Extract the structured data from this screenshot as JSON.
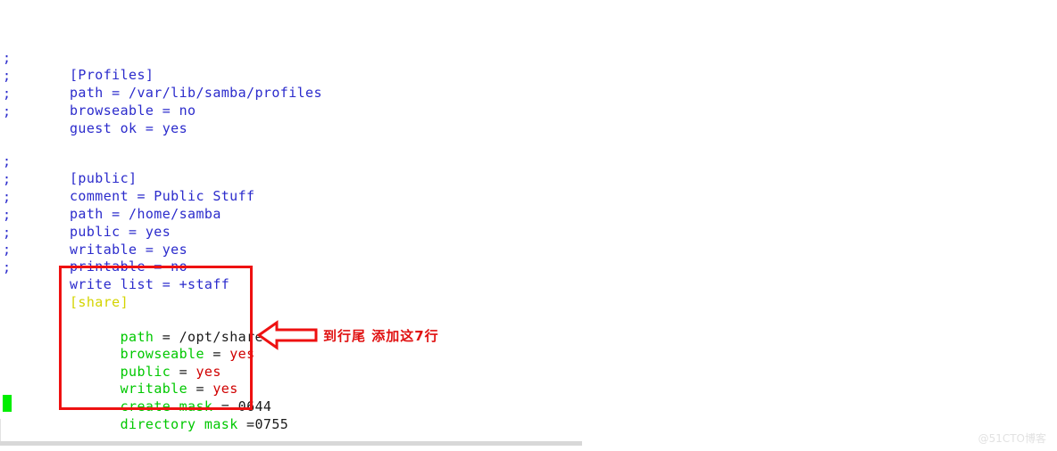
{
  "editor": {
    "comment_marker": ";",
    "blue_color": "#2b2bcc",
    "blocks": [
      {
        "name": "profiles-block",
        "lines": [
          {
            "marker": ";",
            "text": "[Profiles]"
          },
          {
            "marker": ";",
            "text": "path = /var/lib/samba/profiles"
          },
          {
            "marker": ";",
            "text": "browseable = no"
          },
          {
            "marker": ";",
            "text": "guest ok = yes"
          }
        ]
      },
      {
        "name": "public-block",
        "lines": [
          {
            "marker": ";",
            "text": "[public]"
          },
          {
            "marker": ";",
            "text": "comment = Public Stuff"
          },
          {
            "marker": ";",
            "text": "path = /home/samba"
          },
          {
            "marker": ";",
            "text": "public = yes"
          },
          {
            "marker": ";",
            "text": "writable = yes"
          },
          {
            "marker": ";",
            "text": "printable = no"
          },
          {
            "marker": ";",
            "text": "write list = +staff"
          }
        ]
      }
    ],
    "share_block": {
      "name": "share-block",
      "section": "[share]",
      "section_color": "#d4d400",
      "key_color": "#00c800",
      "value_red": "#d00000",
      "value_dark": "#1a1a1a",
      "lines": [
        {
          "key": "path",
          "eq": " = ",
          "value": "/opt/share",
          "value_style": "dark"
        },
        {
          "key": "browseable",
          "eq": " = ",
          "value": "yes",
          "value_style": "red"
        },
        {
          "key": "public",
          "eq": " = ",
          "value": "yes",
          "value_style": "red"
        },
        {
          "key": "writable",
          "eq": " = ",
          "value": "yes",
          "value_style": "red"
        },
        {
          "key": "create mask",
          "eq": " = ",
          "value": "0644",
          "value_style": "dark"
        },
        {
          "key": "directory mask",
          "eq": " =",
          "value": "0755",
          "value_style": "dark"
        }
      ]
    },
    "cursor": {
      "name": "text-cursor",
      "color": "#00ee00"
    }
  },
  "annotation": {
    "text": "到行尾 添加这7行",
    "color": "#e01010",
    "arrow": {
      "direction": "left",
      "stroke": "#ee1111",
      "fill": "#ffffff"
    },
    "highlight_box": {
      "color": "#ee1111"
    }
  },
  "chrome": {
    "watermark": "@51CTO博客",
    "scrollbar_color": "#d8d8d8"
  }
}
